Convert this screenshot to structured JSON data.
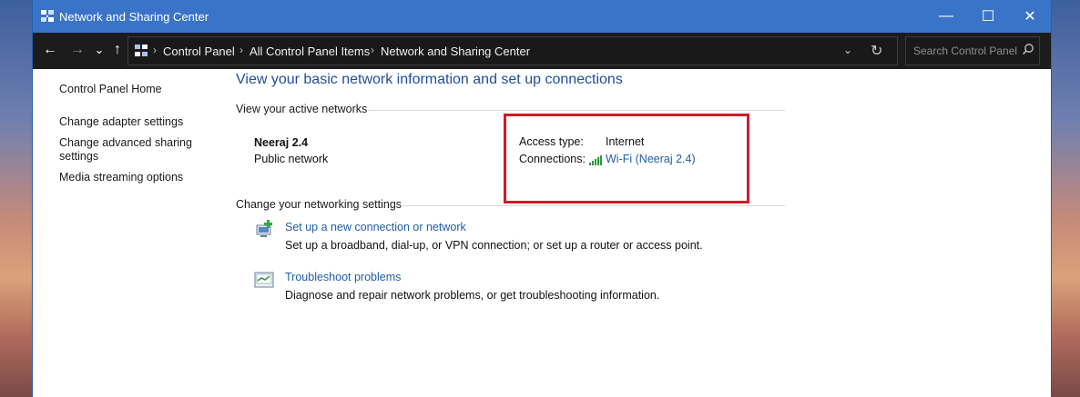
{
  "window": {
    "title": "Network and Sharing Center",
    "controls": {
      "minimize": "—",
      "maximize": "☐",
      "close": "✕"
    }
  },
  "nav": {
    "back": "←",
    "forward": "→",
    "recent": "⌄",
    "up": "↑",
    "breadcrumbs": [
      "Control Panel",
      "All Control Panel Items",
      "Network and Sharing Center"
    ],
    "separator": "›",
    "dropdown": "⌄",
    "refresh": "↻",
    "search_placeholder": "Search Control Panel"
  },
  "sidebar": {
    "items": [
      {
        "label": "Control Panel Home"
      },
      {
        "label": "Change adapter settings"
      },
      {
        "label": "Change advanced sharing settings"
      },
      {
        "label": "Media streaming options"
      }
    ]
  },
  "main": {
    "heading": "View your basic network information and set up connections",
    "active_networks_label": "View your active networks",
    "network": {
      "name": "Neeraj 2.4",
      "category": "Public network",
      "access_type_label": "Access type:",
      "access_type_value": "Internet",
      "connections_label": "Connections:",
      "connection_link": "Wi-Fi (Neeraj 2.4)"
    },
    "change_settings_label": "Change your networking settings",
    "tasks": [
      {
        "title": "Set up a new connection or network",
        "desc": "Set up a broadband, dial-up, or VPN connection; or set up a router or access point."
      },
      {
        "title": "Troubleshoot problems",
        "desc": "Diagnose and repair network problems, or get troubleshooting information."
      }
    ]
  },
  "colors": {
    "titlebar": "#3a74c8",
    "navbar": "#1c1c1c",
    "link": "#1f5fa8",
    "heading": "#1e4e9c",
    "highlight": "#d01c28"
  }
}
